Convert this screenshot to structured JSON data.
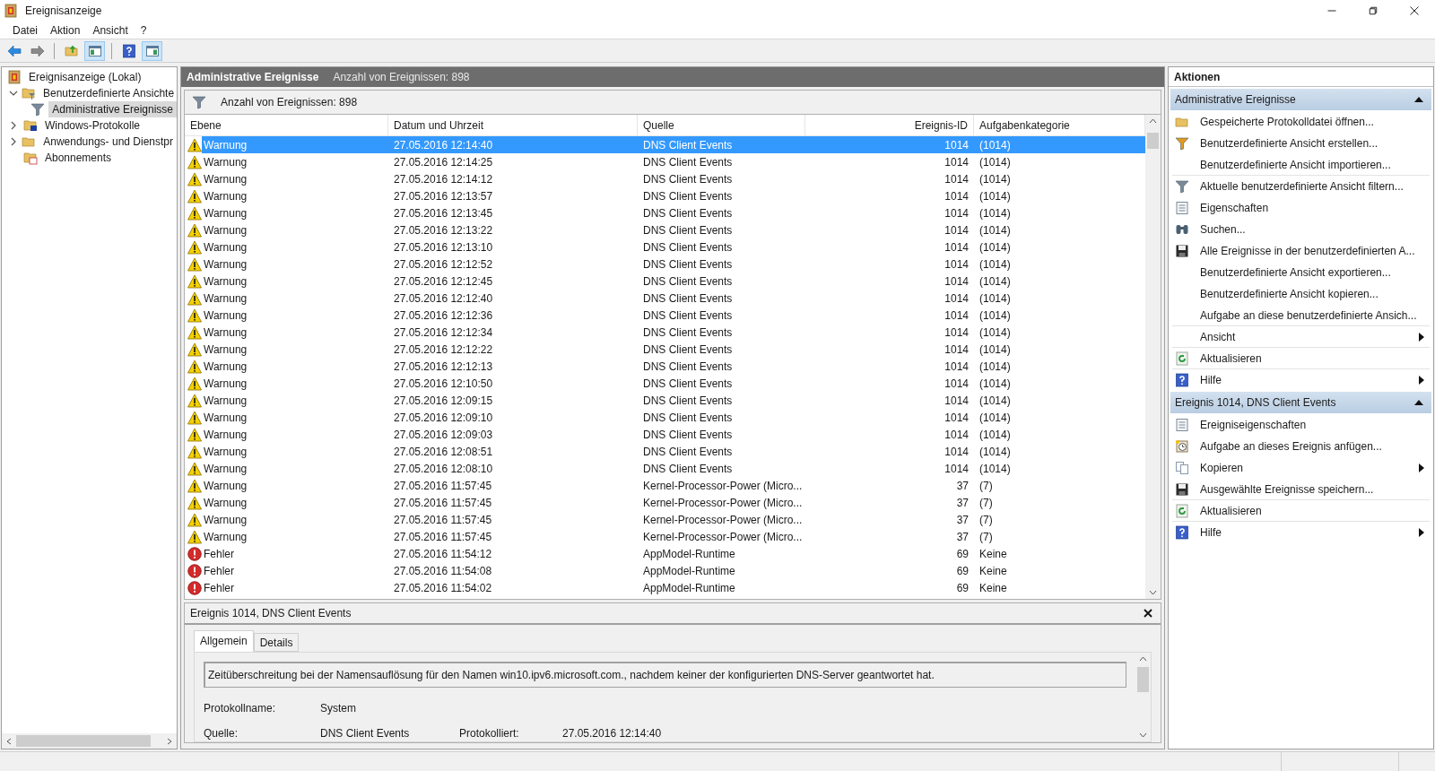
{
  "window": {
    "title": "Ereignisanzeige"
  },
  "menu": [
    "Datei",
    "Aktion",
    "Ansicht",
    "?"
  ],
  "toolbar": [
    {
      "kind": "back",
      "pressed": false
    },
    {
      "kind": "forward",
      "pressed": false
    },
    {
      "kind": "separator"
    },
    {
      "kind": "folder-up",
      "pressed": false
    },
    {
      "kind": "tree-pane",
      "pressed": true
    },
    {
      "kind": "separator"
    },
    {
      "kind": "help",
      "pressed": false
    },
    {
      "kind": "action-pane",
      "pressed": true
    }
  ],
  "tree": [
    {
      "label": "Ereignisanzeige (Lokal)",
      "kind": "viewer",
      "selected": false,
      "children": [
        {
          "label": "Benutzerdefinierte Ansichte",
          "kind": "filter-folder",
          "expanded": true,
          "selected": false,
          "children": [
            {
              "label": "Administrative Ereignisse",
              "kind": "filter",
              "selected": true
            }
          ]
        },
        {
          "label": "Windows-Protokolle",
          "kind": "log-folder",
          "expanded": false,
          "selected": false
        },
        {
          "label": "Anwendungs- und Dienstpr",
          "kind": "folder",
          "expanded": false,
          "selected": false
        },
        {
          "label": "Abonnements",
          "kind": "subscription",
          "selected": false
        }
      ]
    }
  ],
  "center": {
    "title": "Administrative Ereignisse",
    "subtitle": "Anzahl von Ereignissen: 898",
    "filter_text": "Anzahl von Ereignissen: 898"
  },
  "table": {
    "columns": [
      "Ebene",
      "Datum und Uhrzeit",
      "Quelle",
      "Ereignis-ID",
      "Aufgabenkategorie"
    ],
    "rows": [
      {
        "kind": "warning",
        "level_text": "Warnung",
        "date": "27.05.2016 12:14:40",
        "source": "DNS Client Events",
        "id": "1014",
        "category": "(1014)",
        "selected": true
      },
      {
        "kind": "warning",
        "level_text": "Warnung",
        "date": "27.05.2016 12:14:25",
        "source": "DNS Client Events",
        "id": "1014",
        "category": "(1014)",
        "selected": false
      },
      {
        "kind": "warning",
        "level_text": "Warnung",
        "date": "27.05.2016 12:14:12",
        "source": "DNS Client Events",
        "id": "1014",
        "category": "(1014)",
        "selected": false
      },
      {
        "kind": "warning",
        "level_text": "Warnung",
        "date": "27.05.2016 12:13:57",
        "source": "DNS Client Events",
        "id": "1014",
        "category": "(1014)",
        "selected": false
      },
      {
        "kind": "warning",
        "level_text": "Warnung",
        "date": "27.05.2016 12:13:45",
        "source": "DNS Client Events",
        "id": "1014",
        "category": "(1014)",
        "selected": false
      },
      {
        "kind": "warning",
        "level_text": "Warnung",
        "date": "27.05.2016 12:13:22",
        "source": "DNS Client Events",
        "id": "1014",
        "category": "(1014)",
        "selected": false
      },
      {
        "kind": "warning",
        "level_text": "Warnung",
        "date": "27.05.2016 12:13:10",
        "source": "DNS Client Events",
        "id": "1014",
        "category": "(1014)",
        "selected": false
      },
      {
        "kind": "warning",
        "level_text": "Warnung",
        "date": "27.05.2016 12:12:52",
        "source": "DNS Client Events",
        "id": "1014",
        "category": "(1014)",
        "selected": false
      },
      {
        "kind": "warning",
        "level_text": "Warnung",
        "date": "27.05.2016 12:12:45",
        "source": "DNS Client Events",
        "id": "1014",
        "category": "(1014)",
        "selected": false
      },
      {
        "kind": "warning",
        "level_text": "Warnung",
        "date": "27.05.2016 12:12:40",
        "source": "DNS Client Events",
        "id": "1014",
        "category": "(1014)",
        "selected": false
      },
      {
        "kind": "warning",
        "level_text": "Warnung",
        "date": "27.05.2016 12:12:36",
        "source": "DNS Client Events",
        "id": "1014",
        "category": "(1014)",
        "selected": false
      },
      {
        "kind": "warning",
        "level_text": "Warnung",
        "date": "27.05.2016 12:12:34",
        "source": "DNS Client Events",
        "id": "1014",
        "category": "(1014)",
        "selected": false
      },
      {
        "kind": "warning",
        "level_text": "Warnung",
        "date": "27.05.2016 12:12:22",
        "source": "DNS Client Events",
        "id": "1014",
        "category": "(1014)",
        "selected": false
      },
      {
        "kind": "warning",
        "level_text": "Warnung",
        "date": "27.05.2016 12:12:13",
        "source": "DNS Client Events",
        "id": "1014",
        "category": "(1014)",
        "selected": false
      },
      {
        "kind": "warning",
        "level_text": "Warnung",
        "date": "27.05.2016 12:10:50",
        "source": "DNS Client Events",
        "id": "1014",
        "category": "(1014)",
        "selected": false
      },
      {
        "kind": "warning",
        "level_text": "Warnung",
        "date": "27.05.2016 12:09:15",
        "source": "DNS Client Events",
        "id": "1014",
        "category": "(1014)",
        "selected": false
      },
      {
        "kind": "warning",
        "level_text": "Warnung",
        "date": "27.05.2016 12:09:10",
        "source": "DNS Client Events",
        "id": "1014",
        "category": "(1014)",
        "selected": false
      },
      {
        "kind": "warning",
        "level_text": "Warnung",
        "date": "27.05.2016 12:09:03",
        "source": "DNS Client Events",
        "id": "1014",
        "category": "(1014)",
        "selected": false
      },
      {
        "kind": "warning",
        "level_text": "Warnung",
        "date": "27.05.2016 12:08:51",
        "source": "DNS Client Events",
        "id": "1014",
        "category": "(1014)",
        "selected": false
      },
      {
        "kind": "warning",
        "level_text": "Warnung",
        "date": "27.05.2016 12:08:10",
        "source": "DNS Client Events",
        "id": "1014",
        "category": "(1014)",
        "selected": false
      },
      {
        "kind": "warning",
        "level_text": "Warnung",
        "date": "27.05.2016 11:57:45",
        "source": "Kernel-Processor-Power (Micro...",
        "id": "37",
        "category": "(7)",
        "selected": false
      },
      {
        "kind": "warning",
        "level_text": "Warnung",
        "date": "27.05.2016 11:57:45",
        "source": "Kernel-Processor-Power (Micro...",
        "id": "37",
        "category": "(7)",
        "selected": false
      },
      {
        "kind": "warning",
        "level_text": "Warnung",
        "date": "27.05.2016 11:57:45",
        "source": "Kernel-Processor-Power (Micro...",
        "id": "37",
        "category": "(7)",
        "selected": false
      },
      {
        "kind": "warning",
        "level_text": "Warnung",
        "date": "27.05.2016 11:57:45",
        "source": "Kernel-Processor-Power (Micro...",
        "id": "37",
        "category": "(7)",
        "selected": false
      },
      {
        "kind": "error",
        "level_text": "Fehler",
        "date": "27.05.2016 11:54:12",
        "source": "AppModel-Runtime",
        "id": "69",
        "category": "Keine",
        "selected": false
      },
      {
        "kind": "error",
        "level_text": "Fehler",
        "date": "27.05.2016 11:54:08",
        "source": "AppModel-Runtime",
        "id": "69",
        "category": "Keine",
        "selected": false
      },
      {
        "kind": "error",
        "level_text": "Fehler",
        "date": "27.05.2016 11:54:02",
        "source": "AppModel-Runtime",
        "id": "69",
        "category": "Keine",
        "selected": false
      }
    ]
  },
  "detail": {
    "title": "Ereignis 1014, DNS Client Events",
    "tabs": [
      {
        "label": "Allgemein",
        "selected": true
      },
      {
        "label": "Details",
        "selected": false
      }
    ],
    "description": "Zeitüberschreitung bei der Namensauflösung für den Namen win10.ipv6.microsoft.com., nachdem keiner der konfigurierten DNS-Server geantwortet hat.",
    "fields": [
      {
        "label": "Protokollname:",
        "value": "System"
      },
      {
        "label": "Quelle:",
        "value": "DNS Client Events"
      },
      {
        "label": "Protokolliert:",
        "value": "27.05.2016 12:14:40"
      }
    ]
  },
  "actions": {
    "title": "Aktionen",
    "sections": [
      {
        "title": "Administrative Ereignisse",
        "items": [
          {
            "kind": "open-folder",
            "label": "Gespeicherte Protokolldatei öffnen...",
            "divider_above": false,
            "submenu": false
          },
          {
            "kind": "filter-add",
            "label": "Benutzerdefinierte Ansicht erstellen...",
            "divider_above": false,
            "submenu": false
          },
          {
            "kind": "none",
            "label": "Benutzerdefinierte Ansicht importieren...",
            "divider_above": false,
            "submenu": false
          },
          {
            "kind": "filter",
            "label": "Aktuelle benutzerdefinierte Ansicht filtern...",
            "divider_above": true,
            "submenu": false
          },
          {
            "kind": "properties",
            "label": "Eigenschaften",
            "divider_above": false,
            "submenu": false
          },
          {
            "kind": "binoculars",
            "label": "Suchen...",
            "divider_above": false,
            "submenu": false
          },
          {
            "kind": "save",
            "label": "Alle Ereignisse in der benutzerdefinierten A...",
            "divider_above": false,
            "submenu": false
          },
          {
            "kind": "none",
            "label": "Benutzerdefinierte Ansicht exportieren...",
            "divider_above": false,
            "submenu": false
          },
          {
            "kind": "none",
            "label": "Benutzerdefinierte Ansicht kopieren...",
            "divider_above": false,
            "submenu": false
          },
          {
            "kind": "none",
            "label": "Aufgabe an diese benutzerdefinierte Ansich...",
            "divider_above": false,
            "submenu": false
          },
          {
            "kind": "none",
            "label": "Ansicht",
            "divider_above": true,
            "submenu": true
          },
          {
            "kind": "refresh",
            "label": "Aktualisieren",
            "divider_above": true,
            "submenu": false
          },
          {
            "kind": "help",
            "label": "Hilfe",
            "divider_above": true,
            "submenu": true
          }
        ]
      },
      {
        "title": "Ereignis 1014, DNS Client Events",
        "items": [
          {
            "kind": "properties",
            "label": "Ereigniseigenschaften",
            "divider_above": false,
            "submenu": false
          },
          {
            "kind": "task",
            "label": "Aufgabe an dieses Ereignis anfügen...",
            "divider_above": false,
            "submenu": false
          },
          {
            "kind": "copy",
            "label": "Kopieren",
            "divider_above": false,
            "submenu": true
          },
          {
            "kind": "save",
            "label": "Ausgewählte Ereignisse speichern...",
            "divider_above": false,
            "submenu": false
          },
          {
            "kind": "refresh",
            "label": "Aktualisieren",
            "divider_above": true,
            "submenu": false
          },
          {
            "kind": "help",
            "label": "Hilfe",
            "divider_above": true,
            "submenu": true
          }
        ]
      }
    ]
  }
}
